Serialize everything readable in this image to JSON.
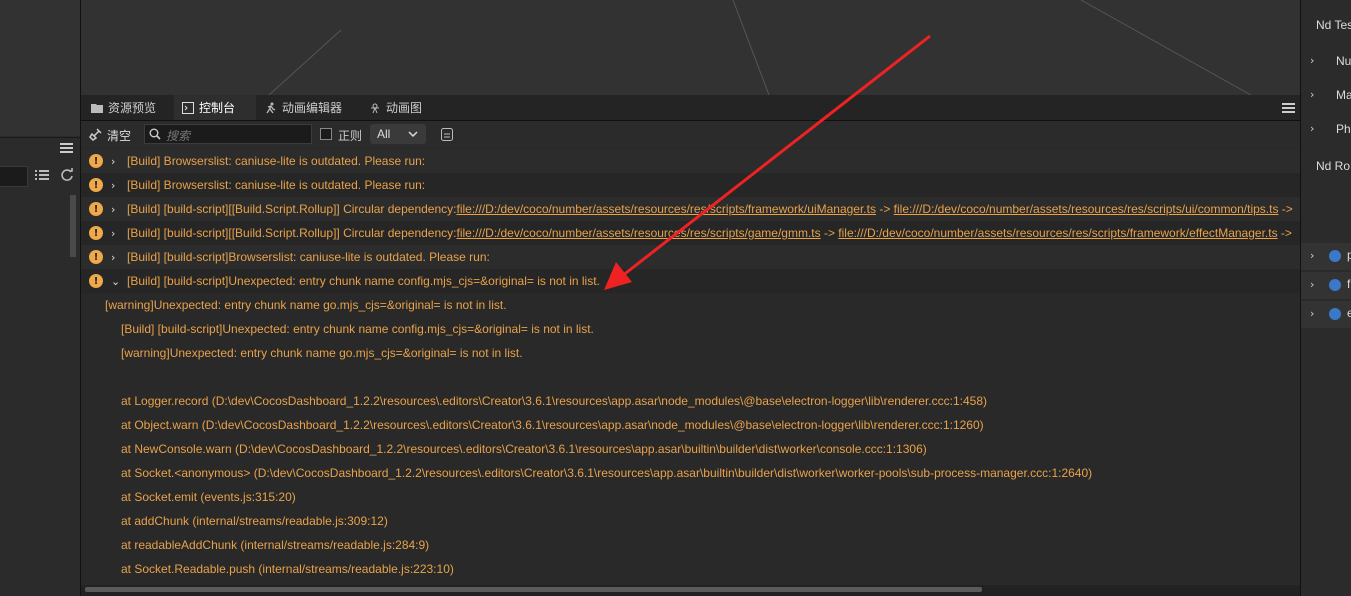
{
  "tabs": [
    {
      "label": "资源预览",
      "icon": "folder-icon"
    },
    {
      "label": "控制台",
      "icon": "terminal-icon",
      "active": true
    },
    {
      "label": "动画编辑器",
      "icon": "running-figure-icon"
    },
    {
      "label": "动画图",
      "icon": "anim-graph-icon"
    }
  ],
  "toolbar": {
    "clear_label": "清空",
    "search_placeholder": "搜索",
    "regex_label": "正则",
    "level_value": "All"
  },
  "logs": [
    {
      "level": "warning",
      "expanded": false,
      "text": "[Build] Browserslist: caniuse-lite is outdated. Please run:"
    },
    {
      "level": "warning",
      "expanded": false,
      "text": "[Build] Browserslist: caniuse-lite is outdated. Please run:"
    },
    {
      "level": "warning",
      "expanded": false,
      "prefix": "[Build] [build-script][[Build.Script.Rollup]] Circular dependency: ",
      "link1": "file:///D:/dev/coco/number/assets/resources/res/scripts/framework/uiManager.ts",
      "arrow": " -> ",
      "link2": "file:///D:/dev/coco/number/assets/resources/res/scripts/ui/common/tips.ts",
      "tail": " -> "
    },
    {
      "level": "warning",
      "expanded": false,
      "prefix": "[Build] [build-script][[Build.Script.Rollup]] Circular dependency: ",
      "link1": "file:///D:/dev/coco/number/assets/resources/res/scripts/game/gmm.ts",
      "arrow": " -> ",
      "link2": "file:///D:/dev/coco/number/assets/resources/res/scripts/framework/effectManager.ts",
      "tail": " -> "
    },
    {
      "level": "warning",
      "expanded": false,
      "text": "[Build] [build-script]Browserslist: caniuse-lite is outdated. Please run:"
    },
    {
      "level": "warning",
      "expanded": true,
      "text": "[Build] [build-script]Unexpected: entry chunk name config.mjs_cjs=&original= is not in list."
    }
  ],
  "expanded_detail": [
    "[warning]Unexpected: entry chunk name go.mjs_cjs=&original= is not in list.",
    "[Build] [build-script]Unexpected: entry chunk name config.mjs_cjs=&original= is not in list.",
    "[warning]Unexpected: entry chunk name go.mjs_cjs=&original= is not in list.",
    "",
    "at Logger.record (D:\\dev\\CocosDashboard_1.2.2\\resources\\.editors\\Creator\\3.6.1\\resources\\app.asar\\node_modules\\@base\\electron-logger\\lib\\renderer.ccc:1:458)",
    "at Object.warn (D:\\dev\\CocosDashboard_1.2.2\\resources\\.editors\\Creator\\3.6.1\\resources\\app.asar\\node_modules\\@base\\electron-logger\\lib\\renderer.ccc:1:1260)",
    "at NewConsole.warn (D:\\dev\\CocosDashboard_1.2.2\\resources\\.editors\\Creator\\3.6.1\\resources\\app.asar\\builtin\\builder\\dist\\worker\\console.ccc:1:1306)",
    "at Socket.<anonymous> (D:\\dev\\CocosDashboard_1.2.2\\resources\\.editors\\Creator\\3.6.1\\resources\\app.asar\\builtin\\builder\\dist\\worker\\worker-pools\\sub-process-manager.ccc:1:2640)",
    "at Socket.emit (events.js:315:20)",
    "at addChunk (internal/streams/readable.js:309:12)",
    "at readableAddChunk (internal/streams/readable.js:284:9)",
    "at Socket.Readable.push (internal/streams/readable.js:223:10)"
  ],
  "right_panel": {
    "items": [
      "Nd Tes",
      "Nu",
      "Ma",
      "Ph",
      "Nd Ro",
      "p",
      "f",
      "e"
    ]
  },
  "colors": {
    "warning_text": "#e8a24a",
    "annotation_arrow": "#ee2222"
  }
}
